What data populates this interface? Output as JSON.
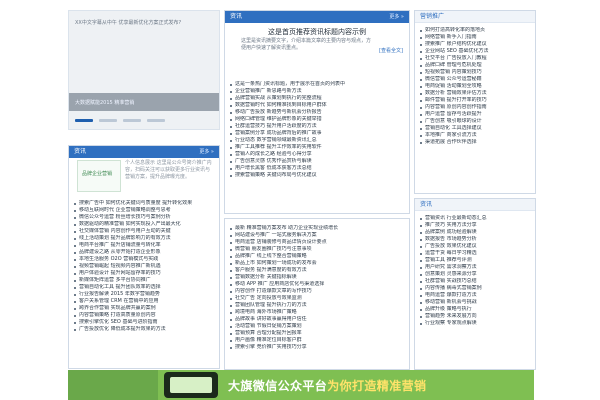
{
  "slide": {
    "top_caption": "XX中文字幕从中午 优享最新优化方案正式发布?",
    "overlay_caption": "大数据赋能2015 精准营销",
    "dots": 4
  },
  "left_lower": {
    "header": "资讯",
    "more": "更多 »",
    "qr_text": "品牌企业营销",
    "promo_text": "个人信息展示 这里是公众号简介推广内容，扫码关注可以获取更多行业资讯与营销方案，提升品牌曝光度。",
    "items": [
      "搜索广告中 如何优化关键词与质量度 提升转化效果",
      "移动互联网时代 企业营销策略调整与思考",
      "微信公众号运营 粉丝增长技巧与案例分析",
      "数据驱动的精准营销 如何实现投入产出最大化",
      "社交媒体营销 内容创作与用户互动的关键",
      "线上活动策划 提升品牌影响力的有效方法",
      "电商平台推广 提升店铺流量与转化率",
      "品牌建设之路 从零开始打造企业形象",
      "本地生活服务 O2O 营销模式与实践",
      "视频营销崛起 短视频内容推广新机遇",
      "用户体验设计 提升网站留存率的技巧",
      "新媒体矩阵运营 多平台协同推广",
      "营销自动化工具 提升团队效率的选择",
      "行业报告解读 2015 年数字营销趋势",
      "客户关系管理 CRM 在营销中的应用",
      "跨界合作营销 实现品牌共赢的案例",
      "内容营销策略 打造高质量原创内容",
      "搜索引擎优化 SEO 基础与进阶指南",
      "广告投放优化 降低成本提升效果的方法"
    ]
  },
  "mid_top": {
    "header": "资讯",
    "more": "更多 »",
    "title": "这是首页推荐资讯标题内容示例",
    "desc": "这里是资讯摘要文字，介绍本篇文章的主要内容与观点，方便用户快速了解资讯重点。",
    "readmore": "[查看全文]",
    "items": [
      "这是一条热门资讯标题，用于展示在首页的列表中",
      "企业营销推广 新思路与新方法",
      "品牌营销实战 从策划到执行的完整流程",
      "数据营销时代 如何精准找到目标用户群体",
      "移动广告投放 新趋势与新机会分析报告",
      "网络口碑管理 维护品牌形象的关键举措",
      "社群运营技巧 提升用户活跃度的方法",
      "营销案例分享 成功品牌背后的推广故事",
      "行业动态 数字营销领域最新资讯汇总",
      "推广工具推荐 提升工作效率的实用软件",
      "营销人的成长之路 经验与心得分享",
      "广告创意灵感 优秀作品赏析与解读",
      "用户增长黑客 低成本获客方法总结",
      "搜索营销策略 关键词布局与优化建议"
    ]
  },
  "mid_bottom": {
    "items": [
      "最新 精准营销方案发布 助力企业实现业绩增长",
      "网站建设与推广 一站式服务解决方案",
      "电商运营 店铺装修与商品详情页设计要点",
      "微营销 朋友圈推广技巧与注意事项",
      "品牌推广 线上线下整合营销策略",
      "新品上市 如何策划一场成功的发布会",
      "客户服务 提升满意度的有效方法",
      "营销数据分析 关键指标解读",
      "移动 APP 推广 应用商店优化与渠道选择",
      "内容创作 打造爆款文章的写作技巧",
      "社交广告 定向投放与效果监测",
      "营销团队管理 提升执行力的方法",
      "跨境电商 海外市场推广策略",
      "品牌故事 讲好故事赢得用户信任",
      "活动营销 节假日促销方案策划",
      "营销预算 合理分配提升回报率",
      "用户画像 精准定位目标客户群",
      "搜索引擎 竞价推广实用技巧分享"
    ]
  },
  "right_top": {
    "header": "营销推广",
    "items": [
      "如何打造高转化率的落地页",
      "网络营销 新手入门指南",
      "搜索推广 账户结构优化建议",
      "企业网站 SEO 基础优化方法",
      "社交平台 广告投放入门教程",
      "品牌口碑 管理与危机处理",
      "短视频营销 内容策划技巧",
      "微信营销 公众号运营秘籍",
      "电商促销 活动策划全攻略",
      "数据分析 营销效果评估方法",
      "邮件营销 提升打开率的技巧",
      "内容营销 原创内容创作指南",
      "用户运营 留存与活跃提升",
      "广告创意 吸引眼球的设计",
      "营销自动化 工具选择建议",
      "本地推广 商家引流方法",
      "渠道拓展 合作伙伴选择"
    ]
  },
  "right_bottom": {
    "header": "资讯",
    "items": [
      "营销资讯 行业最新动态汇总",
      "推广技巧 实用方法分享",
      "品牌案例 成功经验解读",
      "数据报告 市场趋势分析",
      "广告投放 效果优化建议",
      "运营干货 每日学习精选",
      "营销工具 推荐与评测",
      "用户研究 需求洞察方法",
      "创意策划 灵感来源分享",
      "社群营销 实战技巧总结",
      "内容传播 病毒式营销案例",
      "电商运营 爆款打造方法",
      "移动营销 新机会与挑战",
      "品牌升级 策略与执行",
      "营销趋势 未来发展方向",
      "行业观察 专家观点解读"
    ]
  },
  "banner": {
    "text_a": "大旗微信公众平台",
    "text_b": "为你打造精准营销"
  },
  "colors": {
    "accent": "#2f6fc0",
    "banner": "#7fbf52"
  }
}
